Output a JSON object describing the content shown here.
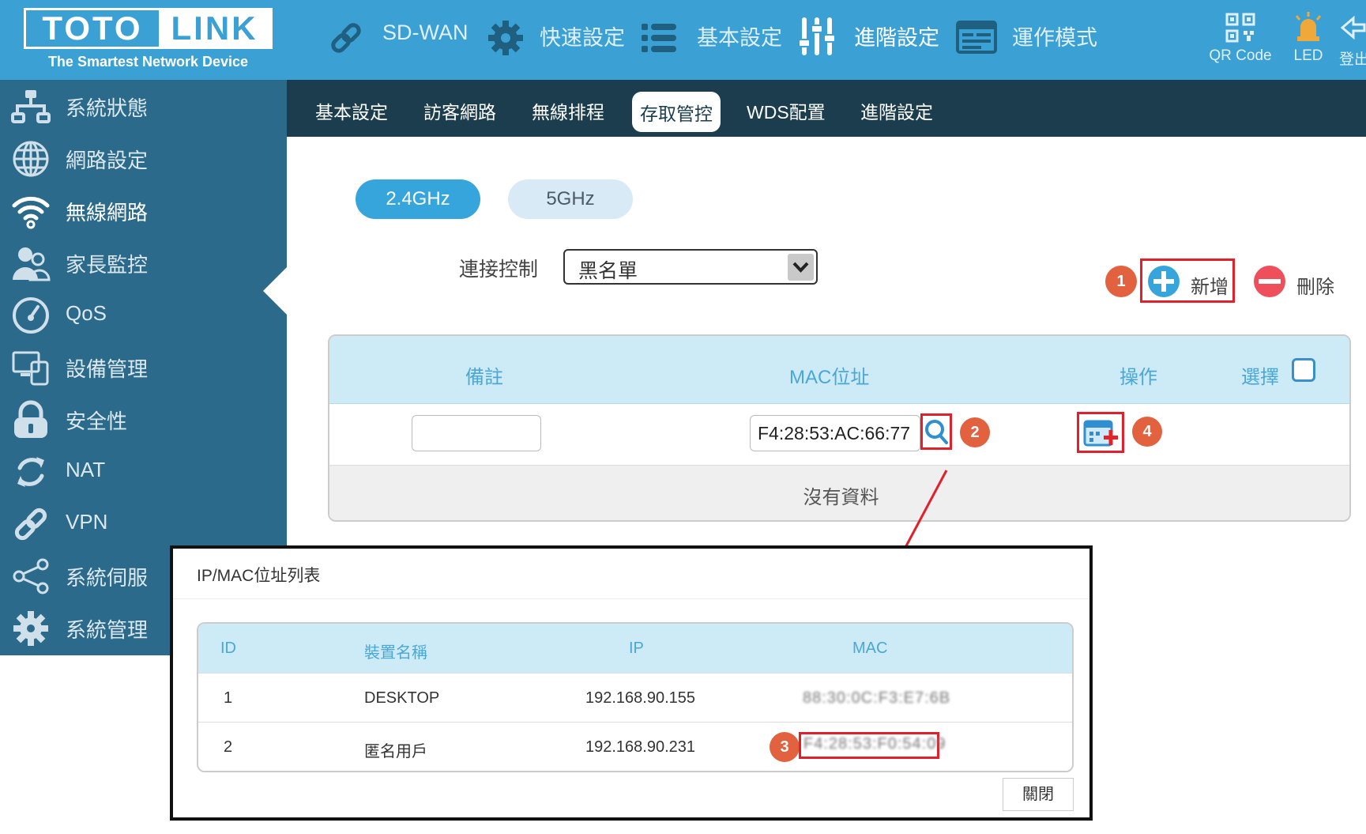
{
  "header": {
    "logo_left": "TOTO",
    "logo_right": "LINK",
    "slogan": "The Smartest Network Device",
    "nav": [
      {
        "label": "SD-WAN",
        "icon": "link-icon"
      },
      {
        "label": "快速設定",
        "icon": "gear-icon"
      },
      {
        "label": "基本設定",
        "icon": "list-icon"
      },
      {
        "label": "進階設定",
        "icon": "sliders-icon"
      },
      {
        "label": "運作模式",
        "icon": "mode-icon"
      }
    ],
    "right": [
      {
        "label": "QR Code",
        "icon": "qrcode-icon"
      },
      {
        "label": "LED",
        "icon": "led-icon"
      },
      {
        "label": "登出",
        "icon": "logout-icon"
      }
    ]
  },
  "sidebar": {
    "items": [
      {
        "label": "系統狀態",
        "icon": "network-status-icon"
      },
      {
        "label": "網路設定",
        "icon": "globe-icon"
      },
      {
        "label": "無線網路",
        "icon": "wifi-icon"
      },
      {
        "label": "家長監控",
        "icon": "users-icon"
      },
      {
        "label": "QoS",
        "icon": "gauge-icon"
      },
      {
        "label": "設備管理",
        "icon": "devices-icon"
      },
      {
        "label": "安全性",
        "icon": "lock-icon"
      },
      {
        "label": "NAT",
        "icon": "refresh-icon"
      },
      {
        "label": "VPN",
        "icon": "link-icon"
      },
      {
        "label": "系統伺服",
        "icon": "share-icon"
      },
      {
        "label": "系統管理",
        "icon": "gear-icon"
      }
    ]
  },
  "subnav": {
    "items": [
      "基本設定",
      "訪客網路",
      "無線排程",
      "存取管控",
      "WDS配置",
      "進階設定"
    ]
  },
  "content": {
    "band_24": "2.4GHz",
    "band_5": "5GHz",
    "control_label": "連接控制",
    "control_value": "黑名單",
    "add_label": "新增",
    "delete_label": "刪除",
    "badges": [
      "1",
      "2",
      "3",
      "4"
    ],
    "table": {
      "headers": [
        "備註",
        "MAC位址",
        "操作",
        "選擇"
      ],
      "mac_value": "F4:28:53:AC:66:77",
      "empty_text": "沒有資料"
    }
  },
  "popup": {
    "title": "IP/MAC位址列表",
    "headers": [
      "ID",
      "裝置名稱",
      "IP",
      "MAC"
    ],
    "rows": [
      {
        "id": "1",
        "name": "DESKTOP",
        "ip": "192.168.90.155",
        "mac": "88:30:0C:F3:E7:6B"
      },
      {
        "id": "2",
        "name": "匿名用戶",
        "ip": "192.168.90.231",
        "mac": "F4:28:53:F0:54:09"
      }
    ],
    "close_label": "關閉"
  },
  "colors": {
    "header_bg": "#3ba0d3",
    "sidebar_bg": "#2b6a8a",
    "subnav_bg": "#1b3d4d",
    "accent": "#35a5dc",
    "badge": "#e2613f",
    "highlight_box": "#e0202a"
  }
}
